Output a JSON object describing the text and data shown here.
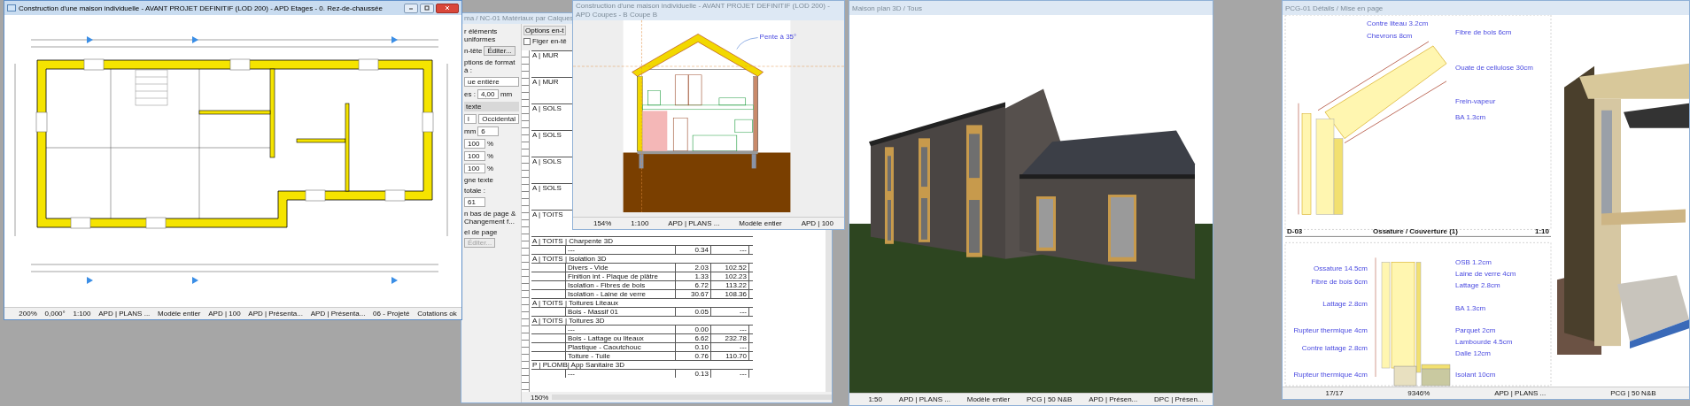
{
  "plan_window": {
    "title": "Construction d'une maison individuelle - AVANT PROJET DEFINITIF (LOD 200) - APD Etages - 0. Rez-de-chaussée",
    "active": true,
    "toolbar": [
      "200%",
      "0,000°",
      "1:100",
      "APD | PLANS ...",
      "Modèle entier",
      "APD | 100",
      "APD | Présenta...",
      "APD | Présenta...",
      "06 - Projeté",
      "Cotations ok"
    ]
  },
  "schedule_window": {
    "title": "ma / NC-01 Matériaux par Calques",
    "active": false,
    "panel": {
      "rows": [
        [
          {
            "kind": "label",
            "text": "r éléments uniformes"
          }
        ],
        [
          {
            "kind": "label",
            "text": "n-tête"
          },
          {
            "kind": "button",
            "text": "Éditer...",
            "disabled": false
          }
        ],
        [
          {
            "kind": "label",
            "text": "ptions de format à :"
          }
        ],
        [
          {
            "kind": "select",
            "text": "ue entière"
          }
        ],
        [
          {
            "kind": "label",
            "text": "es :"
          },
          {
            "kind": "field",
            "text": "4,00"
          },
          {
            "kind": "label",
            "text": "mm"
          }
        ],
        [
          {
            "kind": "section",
            "text": "texte"
          }
        ],
        [
          {
            "kind": "select",
            "text": "l"
          },
          {
            "kind": "select",
            "text": "Occidental"
          }
        ],
        [
          {
            "kind": "label",
            "text": "mm"
          },
          {
            "kind": "field",
            "text": "6"
          }
        ],
        [
          {
            "kind": "field",
            "text": "100"
          },
          {
            "kind": "label",
            "text": "%"
          }
        ],
        [
          {
            "kind": "field",
            "text": "100"
          },
          {
            "kind": "label",
            "text": "%"
          }
        ],
        [
          {
            "kind": "field",
            "text": "100"
          },
          {
            "kind": "label",
            "text": "%"
          }
        ],
        [
          {
            "kind": "label",
            "text": "gne texte"
          }
        ],
        [
          {
            "kind": "label",
            "text": "totale :"
          }
        ],
        [
          {
            "kind": "field",
            "text": "61"
          }
        ],
        [
          {
            "kind": "label",
            "text": "n bas de page & Changement f..."
          }
        ],
        [
          {
            "kind": "label",
            "text": "el de page"
          },
          {
            "kind": "button",
            "text": "Éditer...",
            "disabled": true
          }
        ]
      ]
    },
    "options_button": "Options en-t",
    "freeze": {
      "label": "Figer en-tê",
      "checked": false
    },
    "covered_groups": [
      "A | MUR",
      "A | MUR",
      "A | SOLS",
      "A | SOLS",
      "A | SOLS",
      "A | SOLS",
      "A | TOITS"
    ],
    "rows": [
      {
        "kind": "group",
        "text": "A | TOITS | Charpente 3D"
      },
      {
        "kind": "item",
        "material": "---",
        "qty": "0.34",
        "value": "---"
      },
      {
        "kind": "group",
        "text": "A | TOITS | Isolation 3D"
      },
      {
        "kind": "item",
        "material": "Divers - Vide",
        "qty": "2.03",
        "value": "102.52"
      },
      {
        "kind": "item",
        "material": "Finition int - Plaque de plâtre",
        "qty": "1.33",
        "value": "102.23"
      },
      {
        "kind": "item",
        "material": "Isolation - Fibres de bois",
        "qty": "6.72",
        "value": "113.22"
      },
      {
        "kind": "item",
        "material": "Isolation - Laine de verre",
        "qty": "30.67",
        "value": "108.36"
      },
      {
        "kind": "group",
        "text": "A | TOITS | Toitures Liteaux"
      },
      {
        "kind": "item",
        "material": "Bois - Massif 01",
        "qty": "0.05",
        "value": "---"
      },
      {
        "kind": "group",
        "text": "A | TOITS | Toitures 3D"
      },
      {
        "kind": "item",
        "material": "---",
        "qty": "0.00",
        "value": "---"
      },
      {
        "kind": "item",
        "material": "Bois - Lattage ou liteaux",
        "qty": "6.62",
        "value": "232.78"
      },
      {
        "kind": "item",
        "material": "Plastique - Caoutchouc",
        "qty": "0.10",
        "value": "---"
      },
      {
        "kind": "item",
        "material": "Toiture - Tuile",
        "qty": "0.76",
        "value": "110.70"
      },
      {
        "kind": "group",
        "text": "P | PLOMB| App Sanitaire 3D"
      },
      {
        "kind": "item",
        "material": "---",
        "qty": "0.13",
        "value": "---"
      }
    ],
    "zoom": "150%"
  },
  "section_window": {
    "title": "Construction d'une maison individuelle - AVANT PROJET DEFINITIF (LOD 200) - APD Coupes - B Coupe B",
    "active": false,
    "slope_label": "Pente à 35°",
    "toolbar": [
      "154%",
      "1:100",
      "APD | PLANS ...",
      "Modèle entier",
      "APD | 100"
    ]
  },
  "view3d_window": {
    "title": "Maison plan 3D / Tous",
    "active": false,
    "toolbar": [
      "1:50",
      "APD | PLANS ...",
      "Modèle entier",
      "PCG | 50 N&B",
      "APD | Présen...",
      "DPC | Présen..."
    ]
  },
  "detail_window": {
    "title": "PCG-01 Détails / Mise en page",
    "active": false,
    "upper_labels": [
      "Contre liteau 3.2cm",
      "Chevrons 8cm",
      "Fibre de bois 6cm",
      "Ouate de cellulose 30cm",
      "Frein-vapeur",
      "BA 1.3cm"
    ],
    "drawing_id": "D-03",
    "drawing_title": "Ossature / Couverture (1)",
    "drawing_scale": "1:10",
    "lower_labels": [
      "Ossature 14.5cm",
      "Fibre de bois 6cm",
      "Lattage 2.8cm",
      "Rupteur thermique 4cm",
      "Contre lattage 2.8cm",
      "Rupteur thermique 4cm",
      "OSB 1.2cm",
      "Laine de verre 4cm",
      "Lattage 2.8cm",
      "BA 1.3cm",
      "Parquet 2cm",
      "Lambourde 4.5cm",
      "Dalle 12cm",
      "Isolant 10cm"
    ],
    "toolbar": [
      "17/17",
      "9346%",
      "APD | PLANS ...",
      "PCG | 50 N&B"
    ]
  }
}
